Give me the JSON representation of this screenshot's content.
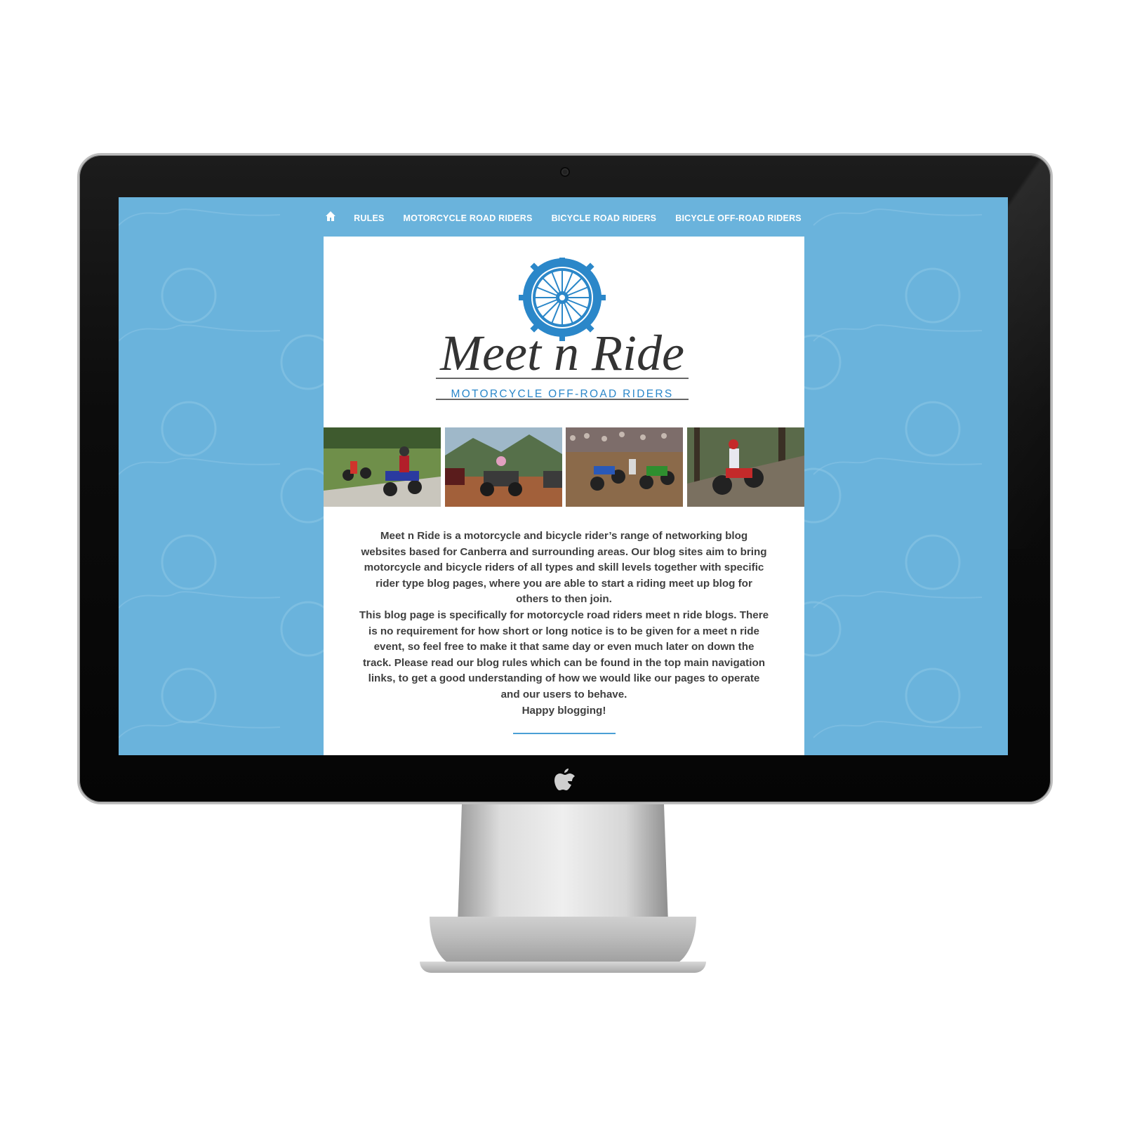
{
  "nav": {
    "home_icon": "home-icon",
    "items": [
      {
        "label": "RULES"
      },
      {
        "label": "MOTORCYCLE ROAD RIDERS"
      },
      {
        "label": "BICYCLE ROAD RIDERS"
      },
      {
        "label": "BICYCLE OFF-ROAD RIDERS"
      }
    ]
  },
  "logo": {
    "title": "Meet n Ride",
    "subtitle": "MOTORCYCLE OFF-ROAD RIDERS"
  },
  "photos": [
    {
      "icon": "photo-dirt-bikes"
    },
    {
      "icon": "photo-quad-bikes"
    },
    {
      "icon": "photo-motocross-race"
    },
    {
      "icon": "photo-trials-rider"
    }
  ],
  "intro": {
    "paragraph1": "Meet n Ride is a motorcycle and bicycle rider’s range of networking blog websites based for Canberra and surrounding areas. Our blog sites aim to bring motorcycle and bicycle riders of all types and skill levels together with specific rider type blog pages, where you are able to start a riding meet up blog for others to then join.",
    "paragraph2": "This blog page is specifically for motorcycle road riders meet n ride blogs. There is no requirement for how short or long notice is to be given for a meet n ride event, so feel free to make it that same day or even much later on down the track. Please read our blog rules which can be found in the top main navigation links, to get a good understanding of how we would like our pages to operate and our users to behave.",
    "closing": "Happy blogging!"
  },
  "colors": {
    "background": "#6ab3dc",
    "accent": "#2b87c9",
    "text": "#3f3f3f",
    "card": "#ffffff"
  }
}
